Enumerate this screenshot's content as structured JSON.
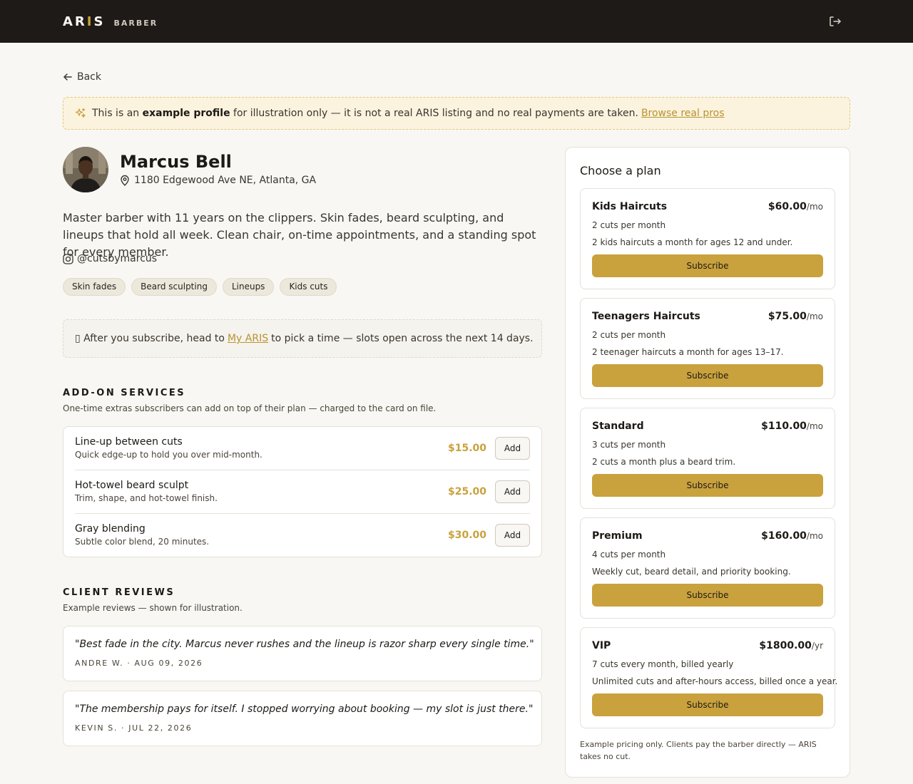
{
  "header": {
    "logo": "ARIS",
    "logo_gold_letter": "I",
    "logo_part1": "AR",
    "logo_part2": "S",
    "tagline": "BARBER"
  },
  "nav": {
    "back_label": "Back"
  },
  "notice": {
    "text_pre": "This is an",
    "text_bold": "example profile",
    "text_post": "for illustration only — it is not a real ARIS listing and no real payments are taken.",
    "link": "Browse real pros"
  },
  "profile": {
    "name": "Marcus Bell",
    "address": "1180 Edgewood Ave NE, Atlanta, GA",
    "bio": "Master barber with 11 years on the clippers. Skin fades, beard sculpting, and lineups that hold all week. Clean chair, on-time appointments, and a standing spot for every member.",
    "instagram": "@cutsbymarcus",
    "tags": [
      "Skin fades",
      "Beard sculpting",
      "Lineups",
      "Kids cuts"
    ]
  },
  "callout": {
    "icon_glyph": "▯",
    "text_pre": "After you subscribe, head to",
    "link": "My ARIS",
    "text_post": "to pick a time — slots open across the next 14 days."
  },
  "addons": {
    "heading": "ADD-ON SERVICES",
    "subheading": "One-time extras subscribers can add on top of their plan — charged to the card on file.",
    "button_label": "Add",
    "items": [
      {
        "name": "Line-up between cuts",
        "desc": "Quick edge-up to hold you over mid-month.",
        "price": "$15.00"
      },
      {
        "name": "Hot-towel beard sculpt",
        "desc": "Trim, shape, and hot-towel finish.",
        "price": "$25.00"
      },
      {
        "name": "Gray blending",
        "desc": "Subtle color blend, 20 minutes.",
        "price": "$30.00"
      }
    ]
  },
  "reviews": {
    "heading": "CLIENT REVIEWS",
    "subheading": "Example reviews — shown for illustration.",
    "items": [
      {
        "quote": "\"Best fade in the city. Marcus never rushes and the lineup is razor sharp every single time.\"",
        "meta": "ANDRE W. · AUG 09, 2026"
      },
      {
        "quote": "\"The membership pays for itself. I stopped worrying about booking — my slot is just there.\"",
        "meta": "KEVIN S. · JUL 22, 2026"
      }
    ]
  },
  "plans": {
    "title": "Choose a plan",
    "button_label": "Subscribe",
    "items": [
      {
        "name": "Kids Haircuts",
        "price": "$60.00",
        "period": "/mo",
        "cuts": "2 cuts per month",
        "desc": "2 kids haircuts a month for ages 12 and under."
      },
      {
        "name": "Teenagers Haircuts",
        "price": "$75.00",
        "period": "/mo",
        "cuts": "2 cuts per month",
        "desc": "2 teenager haircuts a month for ages 13–17."
      },
      {
        "name": "Standard",
        "price": "$110.00",
        "period": "/mo",
        "cuts": "3 cuts per month",
        "desc": "2 cuts a month plus a beard trim."
      },
      {
        "name": "Premium",
        "price": "$160.00",
        "period": "/mo",
        "cuts": "4 cuts per month",
        "desc": "Weekly cut, beard detail, and priority booking."
      },
      {
        "name": "VIP",
        "price": "$1800.00",
        "period": "/yr",
        "cuts": "7 cuts every month, billed yearly",
        "desc": "Unlimited cuts and after-hours access, billed once a year."
      }
    ],
    "footer": "Example pricing only. Clients pay the barber directly — ARIS takes no cut."
  },
  "colors": {
    "accent": "#c9a23e",
    "header_bg": "#1d1a17",
    "page_bg": "#f8f7f3"
  }
}
